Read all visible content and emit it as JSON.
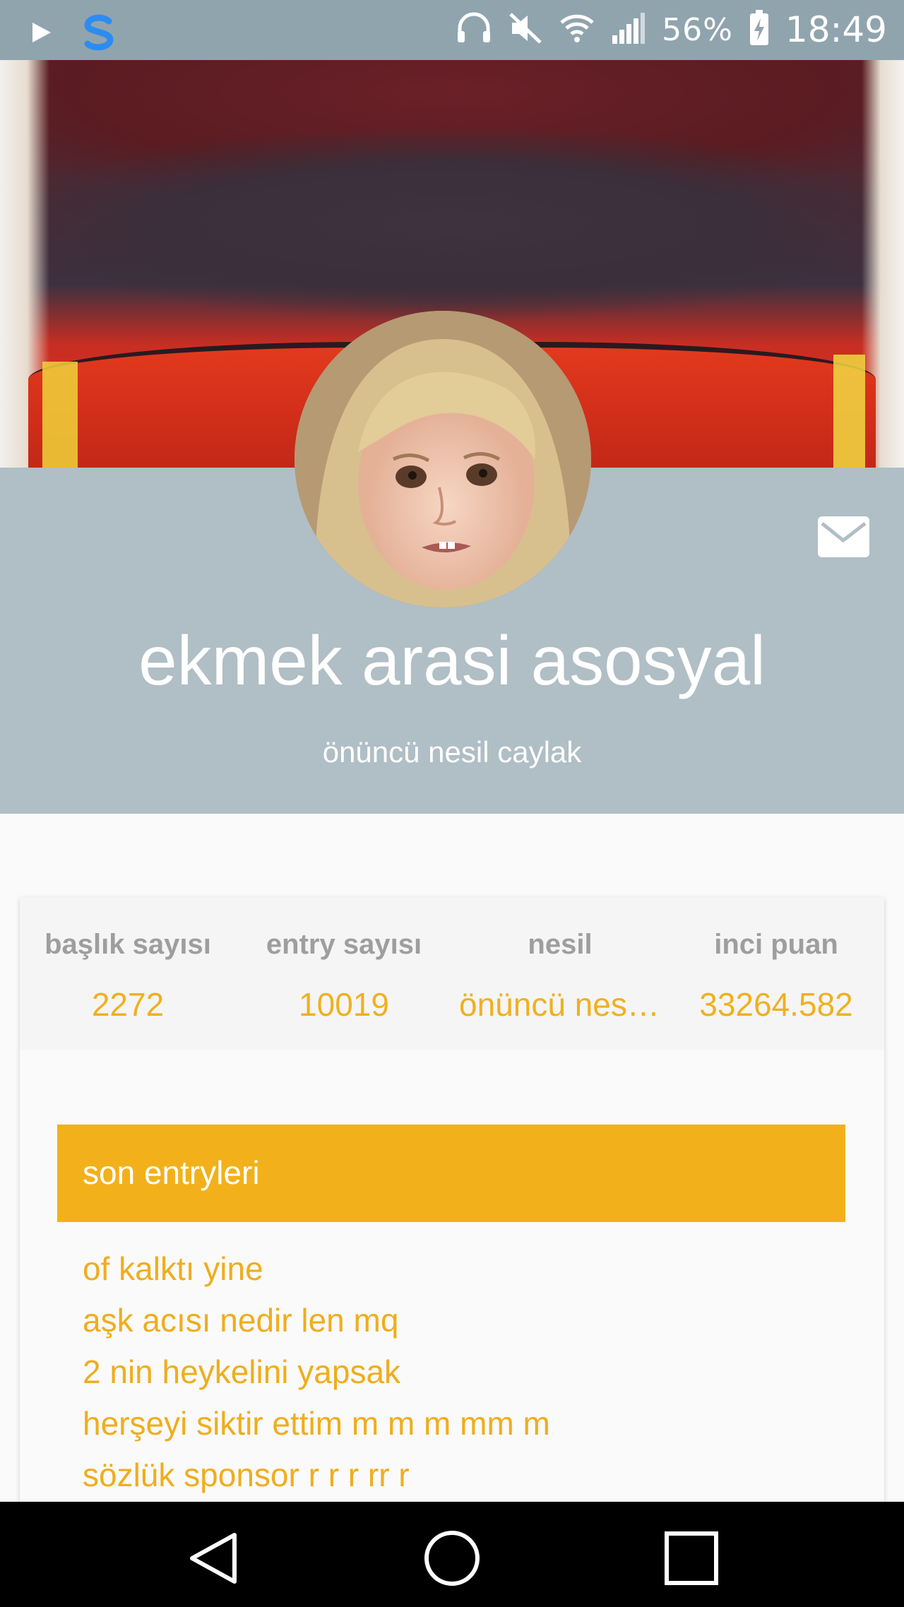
{
  "status_bar": {
    "battery": "56%",
    "time": "18:49",
    "icons": [
      "play-icon",
      "s-app-icon",
      "headset-icon",
      "mute-icon",
      "wifi-icon",
      "signal-icon",
      "battery-charging-icon"
    ]
  },
  "profile": {
    "username": "ekmek arasi asosyal",
    "tagline": "önüncü nesil caylak"
  },
  "stats": [
    {
      "label": "başlık sayısı",
      "value": "2272"
    },
    {
      "label": "entry sayısı",
      "value": "10019"
    },
    {
      "label": "nesil",
      "value": "önüncü nesil caylak"
    },
    {
      "label": "inci puan",
      "value": "33264.582"
    }
  ],
  "entries_section": {
    "title": "son entryleri",
    "items": [
      "of kalktı yine",
      "aşk acısı nedir len mq",
      "2 nin heykelini yapsak",
      "herşeyi siktir ettim m m m mm m",
      "sözlük sponsor r r r rr r"
    ]
  },
  "colors": {
    "status_bar": "#90a4ae",
    "header": "#b0bec5",
    "accent": "#f2b11b",
    "stat_label": "#9e9e9e"
  }
}
